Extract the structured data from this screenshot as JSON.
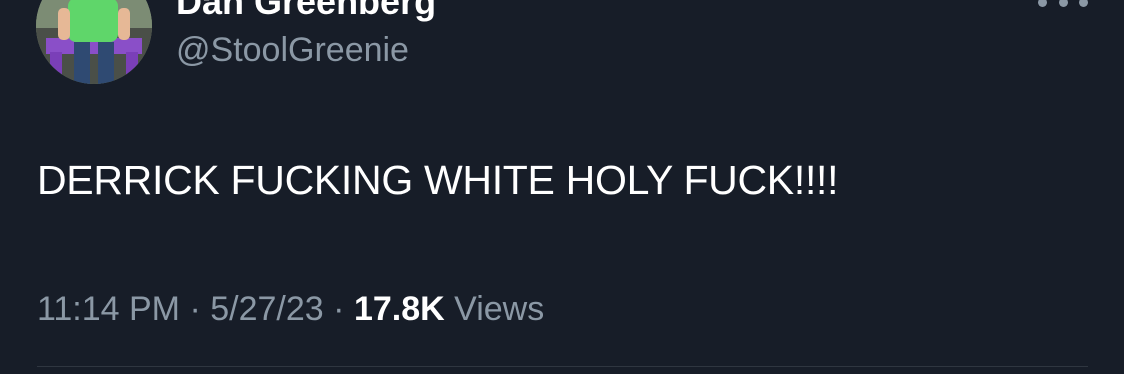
{
  "author": {
    "display_name": "Dan Greenberg",
    "handle": "@StoolGreenie"
  },
  "tweet": {
    "text": "DERRICK FUCKING WHITE HOLY FUCK!!!!"
  },
  "meta": {
    "time": "11:14 PM",
    "separator": "·",
    "date": "5/27/23",
    "views_count": "17.8K",
    "views_label": "Views"
  },
  "colors": {
    "background": "#171d28",
    "primary_text": "#ffffff",
    "secondary_text": "#8b98a5"
  },
  "icons": {
    "more": "more-horizontal-icon"
  }
}
